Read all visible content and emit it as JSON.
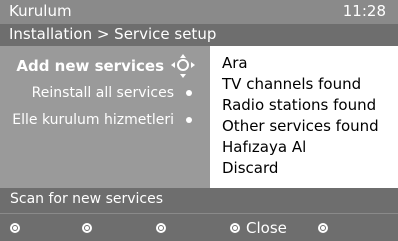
{
  "header": {
    "title": "Kurulum",
    "clock": "11:28"
  },
  "breadcrumb": {
    "text": "Installation > Service setup"
  },
  "menu": {
    "items": [
      {
        "label": "Add new services"
      },
      {
        "label": "Reinstall all services"
      },
      {
        "label": "Elle kurulum hizmetleri"
      }
    ]
  },
  "options": {
    "items": [
      "Ara",
      "TV channels found",
      "Radio stations found",
      "Other services found",
      "Hafızaya Al",
      "Discard"
    ]
  },
  "status": {
    "text": "Scan for new services"
  },
  "buttons": {
    "close_label": "Close"
  },
  "colors": {
    "title_bar": "#8a8a8a",
    "breadcrumb_bar": "#6e6e6e",
    "panel": "#9a9a9a",
    "options_panel": "#ffffff"
  },
  "icons": {
    "selected_item": "navigation-cross-icon",
    "items": "radio-dot-icon",
    "buttons": "remote-button-icon"
  }
}
